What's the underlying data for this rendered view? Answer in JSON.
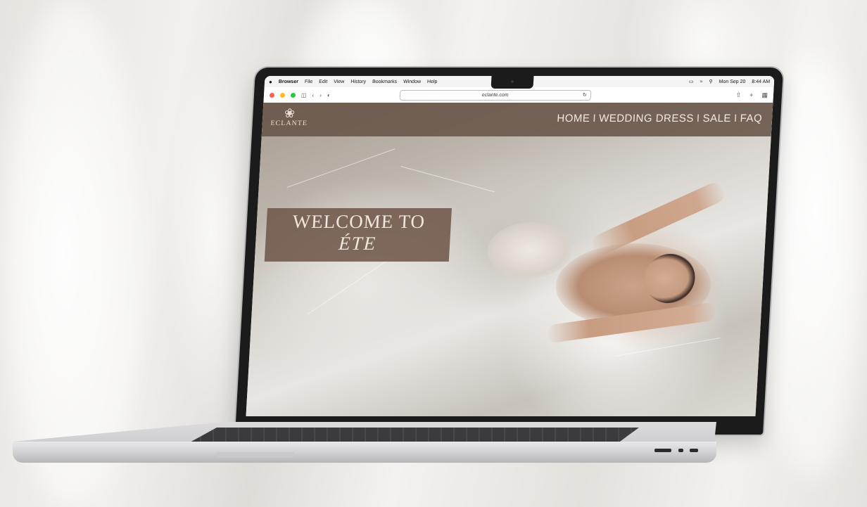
{
  "menubar": {
    "app": "Browser",
    "items": [
      "File",
      "Edit",
      "View",
      "History",
      "Bookmarks",
      "Window",
      "Help"
    ],
    "date": "Mon Sep 20",
    "time": "8:44 AM"
  },
  "browser": {
    "url": "eclante.com"
  },
  "site": {
    "logo_text": "ECLANTE",
    "nav": [
      "HOME",
      "WEDDING DRESS",
      "SALE",
      "FAQ"
    ],
    "nav_separator": "I",
    "hero_line1": "WELCOME TO",
    "hero_line2": "ÉTE"
  },
  "colors": {
    "header_bg": "#685448",
    "hero_box": "#70584a",
    "text_light": "#efe6de"
  }
}
